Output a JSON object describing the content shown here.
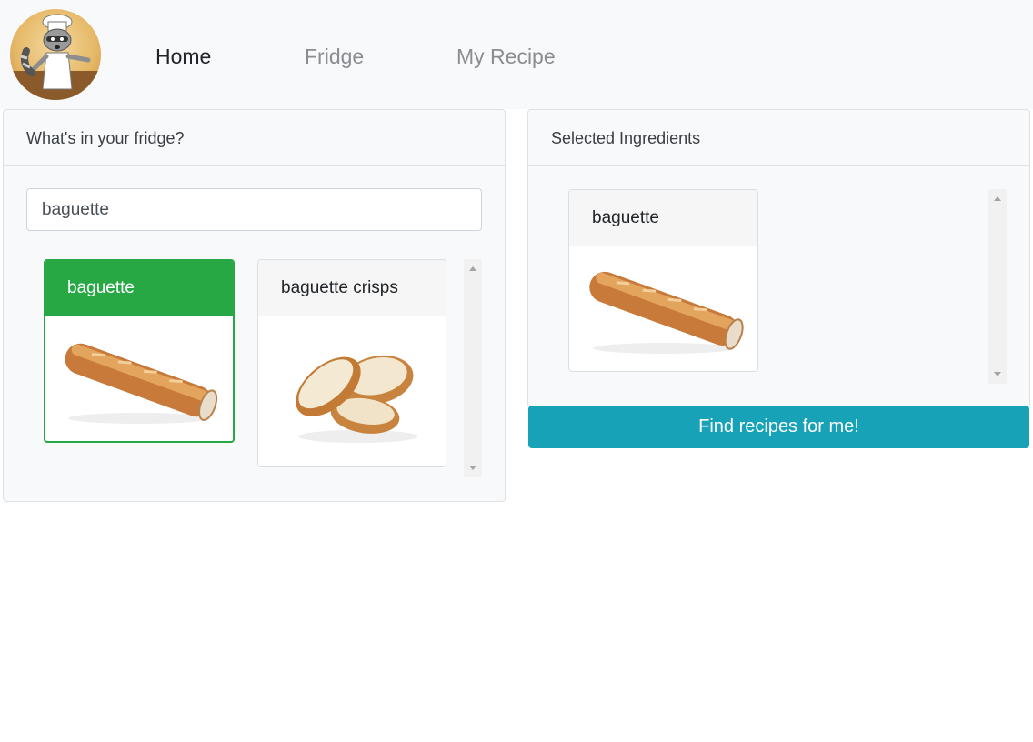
{
  "nav": {
    "logo_icon": "chef-raccoon-logo",
    "links": [
      {
        "label": "Home",
        "active": true
      },
      {
        "label": "Fridge",
        "active": false
      },
      {
        "label": "My Recipe",
        "active": false
      }
    ]
  },
  "fridge_panel": {
    "title": "What's in your fridge?",
    "search_value": "baguette",
    "results": [
      {
        "label": "baguette",
        "selected": true,
        "image": "baguette-image"
      },
      {
        "label": "baguette crisps",
        "selected": false,
        "image": "baguette-crisps-image"
      }
    ]
  },
  "selected_panel": {
    "title": "Selected Ingredients",
    "items": [
      {
        "label": "baguette",
        "image": "baguette-image"
      }
    ],
    "find_button": "Find recipes for me!"
  },
  "colors": {
    "selected_green": "#28a745",
    "button_teal": "#17a2b8",
    "nav_bg": "#f8f9fa"
  }
}
